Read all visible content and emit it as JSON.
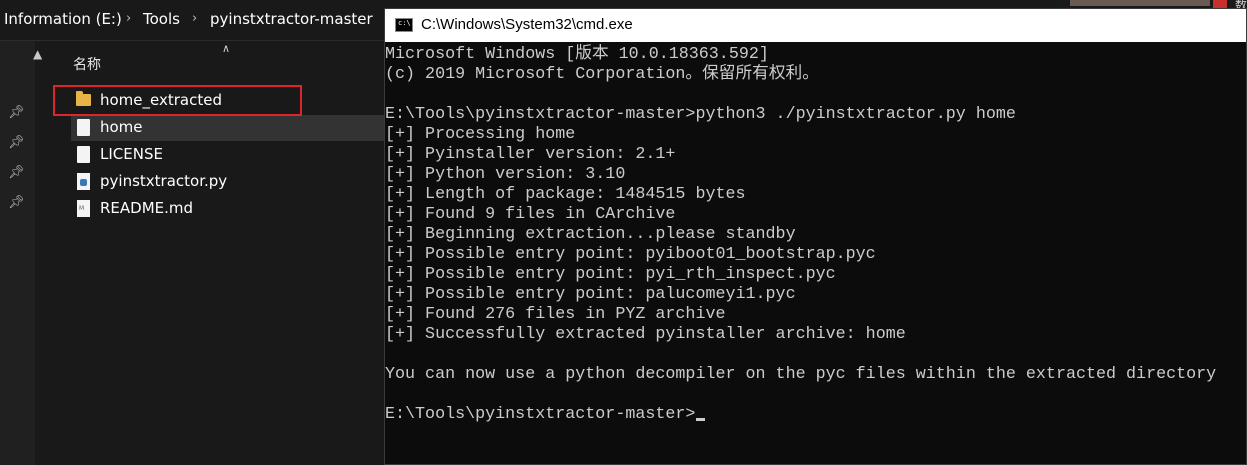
{
  "explorer": {
    "breadcrumb": [
      "Information (E:)",
      "Tools",
      "pyinstxtractor-master"
    ],
    "column_header": "名称",
    "files": [
      {
        "name": "home_extracted",
        "icon": "folder-icon"
      },
      {
        "name": "home",
        "icon": "file-icon",
        "selected": true
      },
      {
        "name": "LICENSE",
        "icon": "file-icon"
      },
      {
        "name": "pyinstxtractor.py",
        "icon": "python-file-icon"
      },
      {
        "name": "README.md",
        "icon": "markdown-file-icon"
      }
    ],
    "highlight_color": "#e0242c",
    "corner_text": "数"
  },
  "cmd": {
    "title": "C:\\Windows\\System32\\cmd.exe",
    "lines": [
      "Microsoft Windows [版本 10.0.18363.592]",
      "(c) 2019 Microsoft Corporation。保留所有权利。",
      "",
      "E:\\Tools\\pyinstxtractor-master>python3 ./pyinstxtractor.py home",
      "[+] Processing home",
      "[+] Pyinstaller version: 2.1+",
      "[+] Python version: 3.10",
      "[+] Length of package: 1484515 bytes",
      "[+] Found 9 files in CArchive",
      "[+] Beginning extraction...please standby",
      "[+] Possible entry point: pyiboot01_bootstrap.pyc",
      "[+] Possible entry point: pyi_rth_inspect.pyc",
      "[+] Possible entry point: palucomeyi1.pyc",
      "[+] Found 276 files in PYZ archive",
      "[+] Successfully extracted pyinstaller archive: home",
      "",
      "You can now use a python decompiler on the pyc files within the extracted directory",
      ""
    ],
    "prompt": "E:\\Tools\\pyinstxtractor-master>",
    "text_color": "#cccccc",
    "background_color": "#0c0c0c"
  }
}
